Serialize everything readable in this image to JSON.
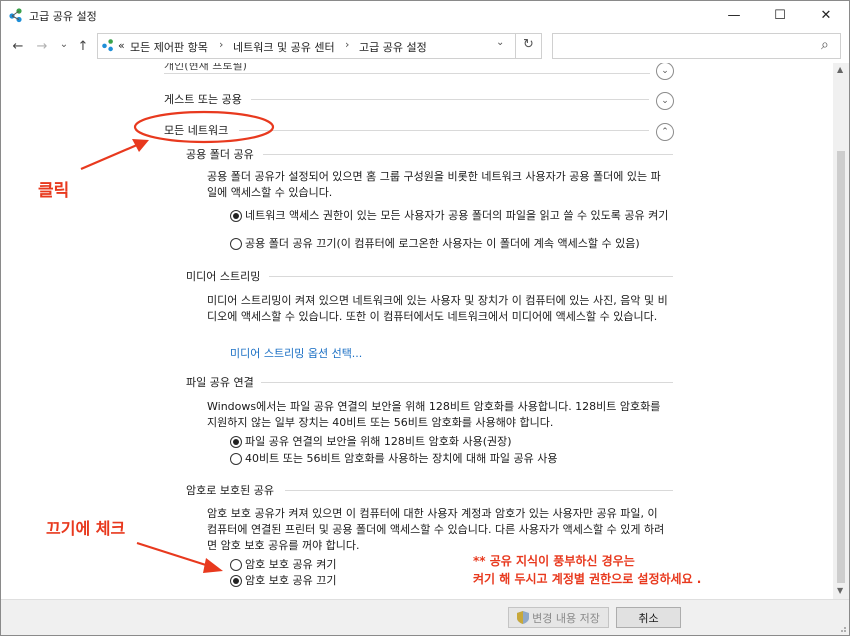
{
  "window": {
    "title": "고급 공유 설정",
    "minimize_glyph": "—",
    "maximize_glyph": "☐",
    "close_glyph": "✕"
  },
  "nav": {
    "back_glyph": "←",
    "forward_glyph": "→",
    "dropdown_glyph": "⌄",
    "up_glyph": "↑",
    "refresh_glyph": "↻",
    "search_glyph": "⌕",
    "breadcrumb_prefix": "«",
    "breadcrumbs": [
      "모든 제어판 항목",
      "네트워크 및 공유 센터",
      "고급 공유 설정"
    ],
    "sep": "›",
    "dropdown_right": "⌄"
  },
  "sections": {
    "private_partial": "개인(현재 프로필)",
    "guest_public": "게스트 또는 공용",
    "all_networks": "모든 네트워크"
  },
  "public_folder": {
    "title": "공용 폴더 공유",
    "desc": "공용 폴더 공유가 설정되어 있으면 홈 그룹 구성원을 비롯한 네트워크 사용자가 공용 폴더에 있는 파일에 액세스할 수 있습니다.",
    "opt_on": "네트워크 액세스 권한이 있는 모든 사용자가 공용 폴더의 파일을 읽고 쓸 수 있도록 공유 켜기",
    "opt_off": "공용 폴더 공유 끄기(이 컴퓨터에 로그온한 사용자는 이 폴더에 계속 액세스할 수 있음)"
  },
  "media": {
    "title": "미디어 스트리밍",
    "desc": "미디어 스트리밍이 켜져 있으면 네트워크에 있는 사용자 및 장치가 이 컴퓨터에 있는 사진, 음악 및 비디오에 액세스할 수 있습니다. 또한 이 컴퓨터에서도 네트워크에서 미디어에 액세스할 수 있습니다.",
    "link": "미디어 스트리밍 옵션 선택..."
  },
  "file_sharing": {
    "title": "파일 공유 연결",
    "desc": "Windows에서는 파일 공유 연결의 보안을 위해 128비트 암호화를 사용합니다. 128비트 암호화를 지원하지 않는 일부 장치는 40비트 또는 56비트 암호화를 사용해야 합니다.",
    "opt_128": "파일 공유 연결의 보안을 위해 128비트 암호화 사용(권장)",
    "opt_40": "40비트 또는 56비트 암호화를 사용하는 장치에 대해 파일 공유 사용"
  },
  "password": {
    "title": "암호로 보호된 공유",
    "desc": "암호 보호 공유가 켜져 있으면 이 컴퓨터에 대한 사용자 계정과 암호가 있는 사용자만 공유 파일, 이 컴퓨터에 연결된 프린터 및 공용 폴더에 액세스할 수 있습니다. 다른 사용자가 액세스할 수 있게 하려면 암호 보호 공유를 꺼야 합니다.",
    "opt_on": "암호 보호 공유 켜기",
    "opt_off": "암호 보호 공유 끄기"
  },
  "footer": {
    "save": "변경 내용 저장",
    "cancel": "취소"
  },
  "annotations": {
    "click": "클릭",
    "check_off": "끄기에 체크",
    "tip_line1": "** 공유 지식이 풍부하신 경우는",
    "tip_line2": "켜기 해 두시고 계정별 권한으로 설정하세요 ."
  },
  "colors": {
    "annotation": "#e8391e",
    "link": "#1a6fc4"
  }
}
